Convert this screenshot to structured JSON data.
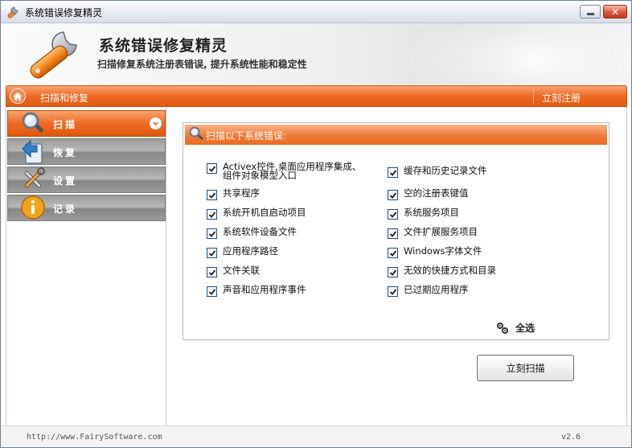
{
  "window": {
    "title": "系统错误修复精灵"
  },
  "banner": {
    "title": "系统错误修复精灵",
    "subtitle": "扫描修复系统注册表错误, 提升系统性能和稳定性"
  },
  "navbar": {
    "section": "扫描和修复",
    "register": "立刻注册"
  },
  "sidebar": {
    "items": [
      {
        "label": "扫描",
        "icon": "magnifier-icon",
        "active": true
      },
      {
        "label": "恢复",
        "icon": "restore-icon",
        "active": false
      },
      {
        "label": "设置",
        "icon": "tools-icon",
        "active": false
      },
      {
        "label": "记录",
        "icon": "info-icon",
        "active": false
      }
    ]
  },
  "panel": {
    "header": "扫描以下系统错误:",
    "left_options": [
      {
        "label_line1": "Activex控件,桌面应用程序集成、",
        "label_line2": "组件对象模型入口",
        "checked": true
      },
      {
        "label_line1": "共享程序",
        "checked": true
      },
      {
        "label_line1": "系统开机自启动项目",
        "checked": true
      },
      {
        "label_line1": "系统软件设备文件",
        "checked": true
      },
      {
        "label_line1": "应用程序路径",
        "checked": true
      },
      {
        "label_line1": "文件关联",
        "checked": true
      },
      {
        "label_line1": "声音和应用程序事件",
        "checked": true
      }
    ],
    "right_options": [
      {
        "label_line1": "缓存和历史记录文件",
        "checked": true
      },
      {
        "label_line1": "空的注册表键值",
        "checked": true
      },
      {
        "label_line1": "系统服务项目",
        "checked": true
      },
      {
        "label_line1": "文件扩展服务项目",
        "checked": true
      },
      {
        "label_line1": "Windows字体文件",
        "checked": true
      },
      {
        "label_line1": "无效的快捷方式和目录",
        "checked": true
      },
      {
        "label_line1": "已过期应用程序",
        "checked": true
      }
    ],
    "select_all": "全选"
  },
  "scan_button": "立刻扫描",
  "statusbar": {
    "url": "http://www.FairySoftware.com",
    "version": "v2.6"
  },
  "colors": {
    "accent": "#ee6a23",
    "sidebar_inactive": "#9b9b9b"
  }
}
